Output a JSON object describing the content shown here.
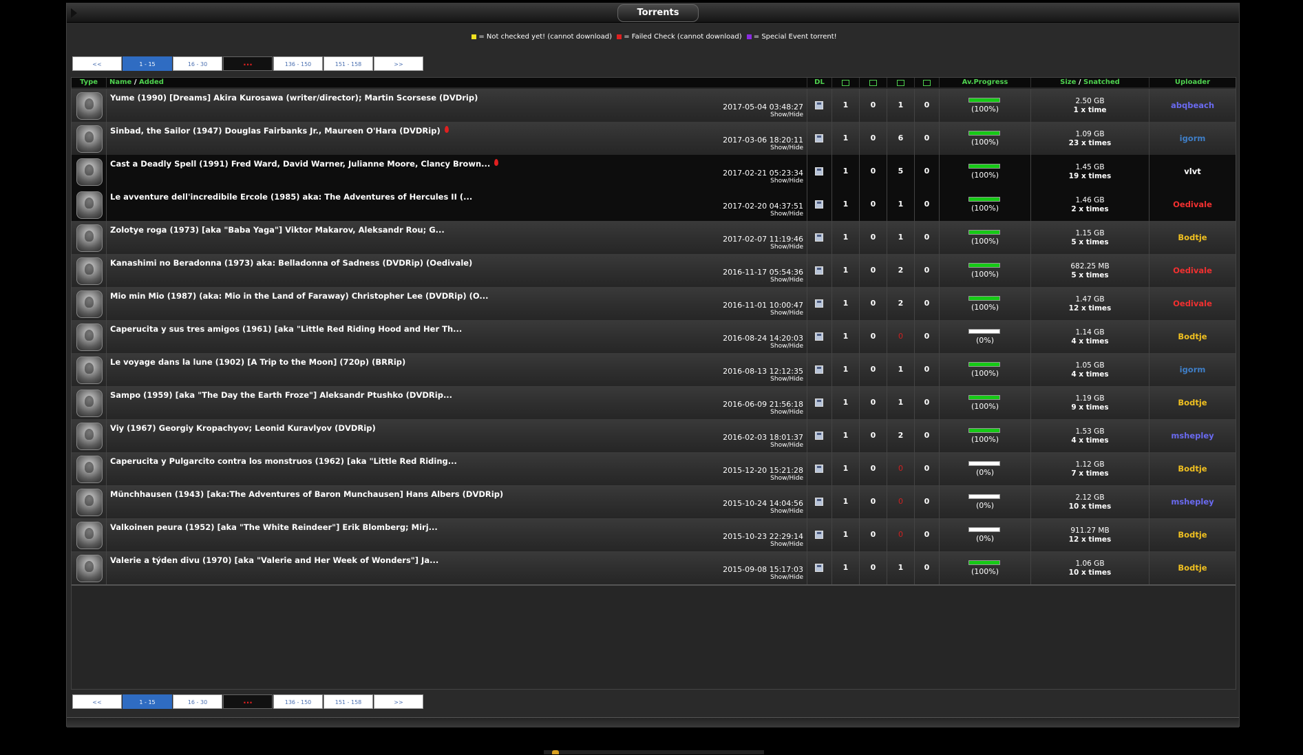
{
  "panel": {
    "title": "Torrents"
  },
  "legend": {
    "yellow": {
      "color": "#f0e020",
      "text": "= Not checked yet! (cannot download)"
    },
    "red": {
      "color": "#e02020",
      "text": "= Failed Check (cannot download)"
    },
    "purple": {
      "color": "#8a2be2",
      "text": "= Special Event torrent!"
    }
  },
  "pagination": {
    "first": "<<",
    "p1": "1 - 15",
    "p2": "16 - 30",
    "dots": "...",
    "p3": "136 - 150",
    "p4": "151 - 158",
    "last": ">>"
  },
  "columns": {
    "type": "Type",
    "name": "Name",
    "slash": "/",
    "added": "Added",
    "dl": "DL",
    "progress": "Av.Progress",
    "size": "Size",
    "snatched": "Snatched",
    "uploader": "Uploader"
  },
  "rows": [
    {
      "name": "Yume (1990) [Dreams] Akira Kurosawa (writer/director); Martin Scorsese (DVDrip)",
      "added": "2017-05-04 03:48:27",
      "show_hide": "Show/Hide",
      "files": "1",
      "comments": "0",
      "seeders": "1",
      "leechers": "0",
      "progress_text": "(100%)",
      "progress": 1.0,
      "size": "2.50 GB",
      "snatched": "1 x time",
      "uploader": "abqbeach",
      "uploader_color": "#6a6af0",
      "flag": false,
      "black": false
    },
    {
      "name": "Sinbad, the Sailor (1947) Douglas Fairbanks Jr., Maureen O'Hara (DVDRip)",
      "added": "2017-03-06 18:20:11",
      "show_hide": "Show/Hide",
      "files": "1",
      "comments": "0",
      "seeders": "6",
      "leechers": "0",
      "progress_text": "(100%)",
      "progress": 1.0,
      "size": "1.09 GB",
      "snatched": "23 x times",
      "uploader": "igorm",
      "uploader_color": "#3f7fc8",
      "flag": true,
      "black": false
    },
    {
      "name": "Cast a Deadly Spell (1991) Fred Ward, David Warner, Julianne Moore, Clancy Brown...",
      "added": "2017-02-21 05:23:34",
      "show_hide": "Show/Hide",
      "files": "1",
      "comments": "0",
      "seeders": "5",
      "leechers": "0",
      "progress_text": "(100%)",
      "progress": 1.0,
      "size": "1.45 GB",
      "snatched": "19 x times",
      "uploader": "vlvt",
      "uploader_color": "#ffffff",
      "flag": true,
      "black": true
    },
    {
      "name": "Le avventure dell'incredibile Ercole (1985) aka: The Adventures of Hercules II (...",
      "added": "2017-02-20 04:37:51",
      "show_hide": "Show/Hide",
      "files": "1",
      "comments": "0",
      "seeders": "1",
      "leechers": "0",
      "progress_text": "(100%)",
      "progress": 1.0,
      "size": "1.46 GB",
      "snatched": "2 x times",
      "uploader": "Oedivale",
      "uploader_color": "#f03030",
      "flag": false,
      "black": true
    },
    {
      "name": "Zolotye roga (1973) [aka \"Baba Yaga\"] Viktor Makarov, Aleksandr Rou; G...",
      "added": "2017-02-07 11:19:46",
      "show_hide": "Show/Hide",
      "files": "1",
      "comments": "0",
      "seeders": "1",
      "leechers": "0",
      "progress_text": "(100%)",
      "progress": 1.0,
      "size": "1.15 GB",
      "snatched": "5 x times",
      "uploader": "Bodtje",
      "uploader_color": "#f0c020",
      "flag": false,
      "black": false
    },
    {
      "name": "Kanashimi no Beradonna (1973) aka: Belladonna of Sadness (DVDRip) (Oedivale)",
      "added": "2016-11-17 05:54:36",
      "show_hide": "Show/Hide",
      "files": "1",
      "comments": "0",
      "seeders": "2",
      "leechers": "0",
      "progress_text": "(100%)",
      "progress": 1.0,
      "size": "682.25 MB",
      "snatched": "5 x times",
      "uploader": "Oedivale",
      "uploader_color": "#f03030",
      "flag": false,
      "black": false
    },
    {
      "name": "Mio min Mio (1987) (aka: Mio in the Land of Faraway) Christopher Lee (DVDRip) (O...",
      "added": "2016-11-01 10:00:47",
      "show_hide": "Show/Hide",
      "files": "1",
      "comments": "0",
      "seeders": "2",
      "leechers": "0",
      "progress_text": "(100%)",
      "progress": 1.0,
      "size": "1.47 GB",
      "snatched": "12 x times",
      "uploader": "Oedivale",
      "uploader_color": "#f03030",
      "flag": false,
      "black": false
    },
    {
      "name": "Caperucita y sus tres amigos (1961) [aka \"Little Red Riding Hood and Her Th...",
      "added": "2016-08-24 14:20:03",
      "show_hide": "Show/Hide",
      "files": "1",
      "comments": "0",
      "seeders": "0",
      "leechers": "0",
      "progress_text": "(0%)",
      "progress": 0.0,
      "size": "1.14 GB",
      "snatched": "4 x times",
      "uploader": "Bodtje",
      "uploader_color": "#f0c020",
      "flag": false,
      "black": false
    },
    {
      "name": "Le voyage dans la lune (1902) [A Trip to the Moon] (720p) (BRRip)",
      "added": "2016-08-13 12:12:35",
      "show_hide": "Show/Hide",
      "files": "1",
      "comments": "0",
      "seeders": "1",
      "leechers": "0",
      "progress_text": "(100%)",
      "progress": 1.0,
      "size": "1.05 GB",
      "snatched": "4 x times",
      "uploader": "igorm",
      "uploader_color": "#3f7fc8",
      "flag": false,
      "black": false
    },
    {
      "name": "Sampo (1959) [aka \"The Day the Earth Froze\"] Aleksandr Ptushko (DVDRip...",
      "added": "2016-06-09 21:56:18",
      "show_hide": "Show/Hide",
      "files": "1",
      "comments": "0",
      "seeders": "1",
      "leechers": "0",
      "progress_text": "(100%)",
      "progress": 1.0,
      "size": "1.19 GB",
      "snatched": "9 x times",
      "uploader": "Bodtje",
      "uploader_color": "#f0c020",
      "flag": false,
      "black": false
    },
    {
      "name": "Viy (1967) Georgiy Kropachyov; Leonid Kuravlyov (DVDRip)",
      "added": "2016-02-03 18:01:37",
      "show_hide": "Show/Hide",
      "files": "1",
      "comments": "0",
      "seeders": "2",
      "leechers": "0",
      "progress_text": "(100%)",
      "progress": 1.0,
      "size": "1.53 GB",
      "snatched": "4 x times",
      "uploader": "mshepley",
      "uploader_color": "#6a6af0",
      "flag": false,
      "black": false
    },
    {
      "name": "Caperucita y Pulgarcito contra los monstruos (1962) [aka \"Little Red Riding...",
      "added": "2015-12-20 15:21:28",
      "show_hide": "Show/Hide",
      "files": "1",
      "comments": "0",
      "seeders": "0",
      "leechers": "0",
      "progress_text": "(0%)",
      "progress": 0.0,
      "size": "1.12 GB",
      "snatched": "7 x times",
      "uploader": "Bodtje",
      "uploader_color": "#f0c020",
      "flag": false,
      "black": false
    },
    {
      "name": "Münchhausen (1943) [aka:The Adventures of Baron Munchausen] Hans Albers (DVDRip)",
      "added": "2015-10-24 14:04:56",
      "show_hide": "Show/Hide",
      "files": "1",
      "comments": "0",
      "seeders": "0",
      "leechers": "0",
      "progress_text": "(0%)",
      "progress": 0.0,
      "size": "2.12 GB",
      "snatched": "10 x times",
      "uploader": "mshepley",
      "uploader_color": "#6a6af0",
      "flag": false,
      "black": false
    },
    {
      "name": "Valkoinen peura (1952) [aka \"The White Reindeer\"] Erik Blomberg; Mirj...",
      "added": "2015-10-23 22:29:14",
      "show_hide": "Show/Hide",
      "files": "1",
      "comments": "0",
      "seeders": "0",
      "leechers": "0",
      "progress_text": "(0%)",
      "progress": 0.0,
      "size": "911.27 MB",
      "snatched": "12 x times",
      "uploader": "Bodtje",
      "uploader_color": "#f0c020",
      "flag": false,
      "black": false
    },
    {
      "name": "Valerie a týden divu (1970) [aka \"Valerie and Her Week of Wonders\"] Ja...",
      "added": "2015-09-08 15:17:03",
      "show_hide": "Show/Hide",
      "files": "1",
      "comments": "0",
      "seeders": "1",
      "leechers": "0",
      "progress_text": "(100%)",
      "progress": 1.0,
      "size": "1.06 GB",
      "snatched": "10 x times",
      "uploader": "Bodtje",
      "uploader_color": "#f0c020",
      "flag": false,
      "black": false
    }
  ]
}
